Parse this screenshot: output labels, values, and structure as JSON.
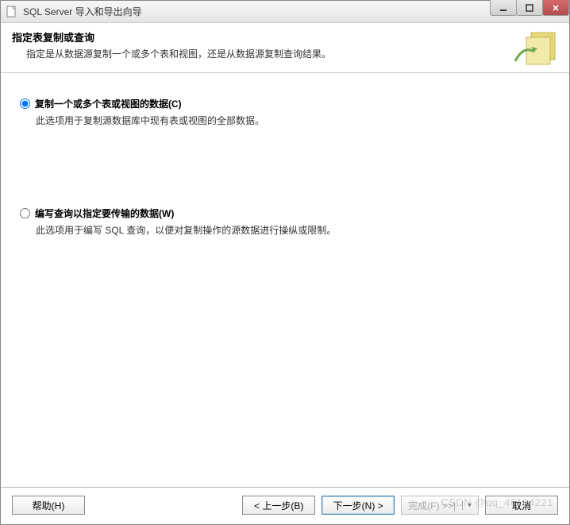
{
  "titlebar": {
    "title": "SQL Server 导入和导出向导"
  },
  "header": {
    "title": "指定表复制或查询",
    "subtitle": "指定是从数据源复制一个或多个表和视图，还是从数据源复制查询结果。"
  },
  "options": [
    {
      "label": "复制一个或多个表或视图的数据(C)",
      "description": "此选项用于复制源数据库中现有表或视图的全部数据。",
      "selected": true
    },
    {
      "label": "编写查询以指定要传输的数据(W)",
      "description": "此选项用于编写 SQL 查询，以便对复制操作的源数据进行操纵或限制。",
      "selected": false
    }
  ],
  "buttons": {
    "help": "帮助(H)",
    "back": "< 上一步(B)",
    "next": "下一步(N) >",
    "finish": "完成(F) >>|",
    "cancel": "取消"
  },
  "watermark": "CSDN @qq_46104221",
  "icons": {
    "app": "document-icon",
    "header": "wizard-step-icon"
  },
  "colors": {
    "accent": "#3c7fb1",
    "header_icon_fill": "#e4d87a",
    "header_icon_accent": "#6aa84f"
  }
}
